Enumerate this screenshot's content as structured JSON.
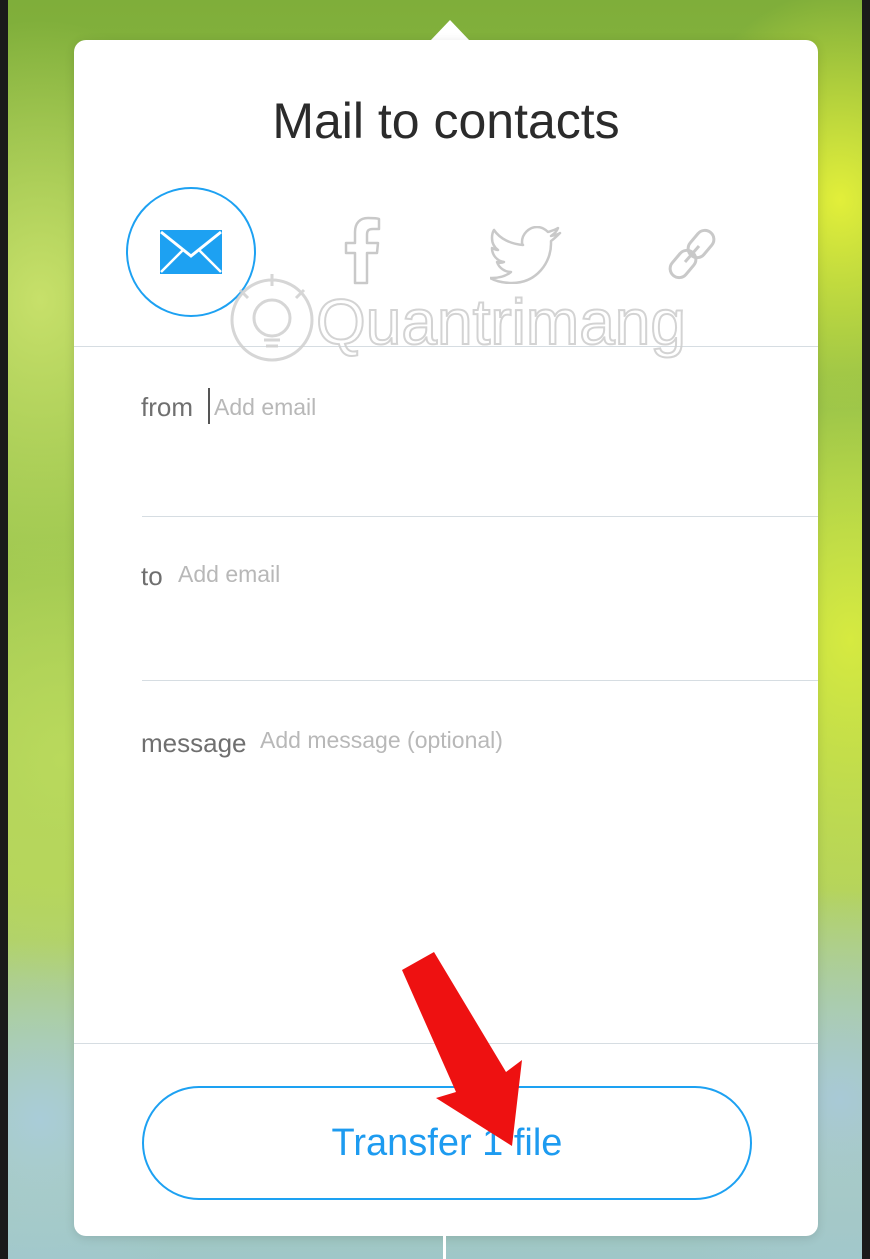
{
  "dialog": {
    "title": "Mail to contacts",
    "share_options": [
      {
        "icon": "mail-icon",
        "selected": true,
        "color": "#1da1f2"
      },
      {
        "icon": "facebook-icon",
        "selected": false
      },
      {
        "icon": "twitter-icon",
        "selected": false
      },
      {
        "icon": "link-icon",
        "selected": false
      }
    ],
    "fields": {
      "from": {
        "label": "from",
        "value": "",
        "placeholder": "Add email"
      },
      "to": {
        "label": "to",
        "value": "",
        "placeholder": "Add email"
      },
      "message": {
        "label": "message",
        "value": "",
        "placeholder": "Add message (optional)"
      }
    },
    "transfer_button": {
      "label": "Transfer 1 file"
    }
  },
  "watermark": {
    "text": "Quantrimang"
  },
  "colors": {
    "accent": "#1da1f2",
    "annotation_arrow": "#ee1111",
    "divider": "#d6dde2"
  }
}
